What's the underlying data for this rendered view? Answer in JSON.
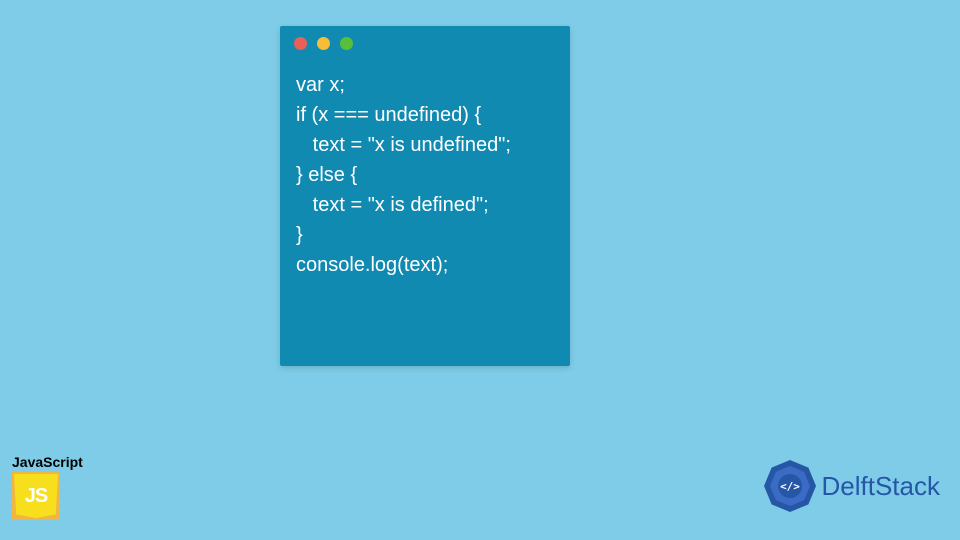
{
  "code": {
    "lines": [
      "var x;",
      "if (x === undefined) {",
      "   text = \"x is undefined\";",
      "} else {",
      "   text = \"x is defined\";",
      "}",
      "console.log(text);"
    ]
  },
  "js_badge": {
    "label": "JavaScript",
    "logo_text": "JS"
  },
  "brand": {
    "name": "DelftStack"
  },
  "colors": {
    "page_bg": "#7ecce8",
    "window_bg": "#118ab2",
    "brand_blue": "#2656a6",
    "js_yellow": "#f7df1e"
  }
}
